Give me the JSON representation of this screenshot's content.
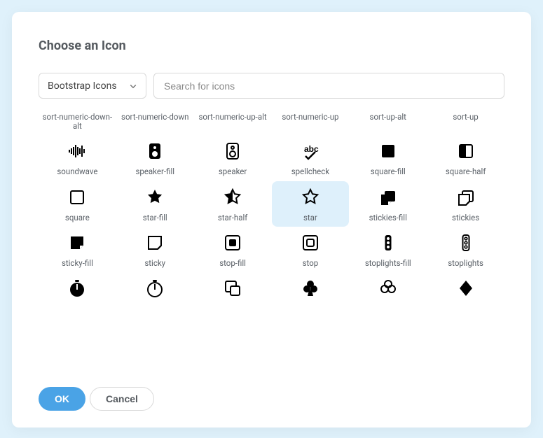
{
  "dialog": {
    "title": "Choose an Icon",
    "ok_label": "OK",
    "cancel_label": "Cancel"
  },
  "controls": {
    "icon_set_selected": "Bootstrap Icons",
    "search_placeholder": "Search for icons"
  },
  "icons": [
    {
      "name": "sort-numeric-down-alt"
    },
    {
      "name": "sort-numeric-down"
    },
    {
      "name": "sort-numeric-up-alt"
    },
    {
      "name": "sort-numeric-up"
    },
    {
      "name": "sort-up-alt"
    },
    {
      "name": "sort-up"
    },
    {
      "name": "soundwave"
    },
    {
      "name": "speaker-fill"
    },
    {
      "name": "speaker"
    },
    {
      "name": "spellcheck"
    },
    {
      "name": "square-fill"
    },
    {
      "name": "square-half"
    },
    {
      "name": "square"
    },
    {
      "name": "star-fill"
    },
    {
      "name": "star-half"
    },
    {
      "name": "star",
      "selected": true
    },
    {
      "name": "stickies-fill"
    },
    {
      "name": "stickies"
    },
    {
      "name": "sticky-fill"
    },
    {
      "name": "sticky"
    },
    {
      "name": "stop-fill"
    },
    {
      "name": "stop"
    },
    {
      "name": "stoplights-fill"
    },
    {
      "name": "stoplights"
    },
    {
      "name": "stopwatch-fill"
    },
    {
      "name": "stopwatch"
    },
    {
      "name": "subtract"
    },
    {
      "name": "suit-club-fill"
    },
    {
      "name": "suit-club"
    },
    {
      "name": "suit-diamond-fill"
    }
  ]
}
